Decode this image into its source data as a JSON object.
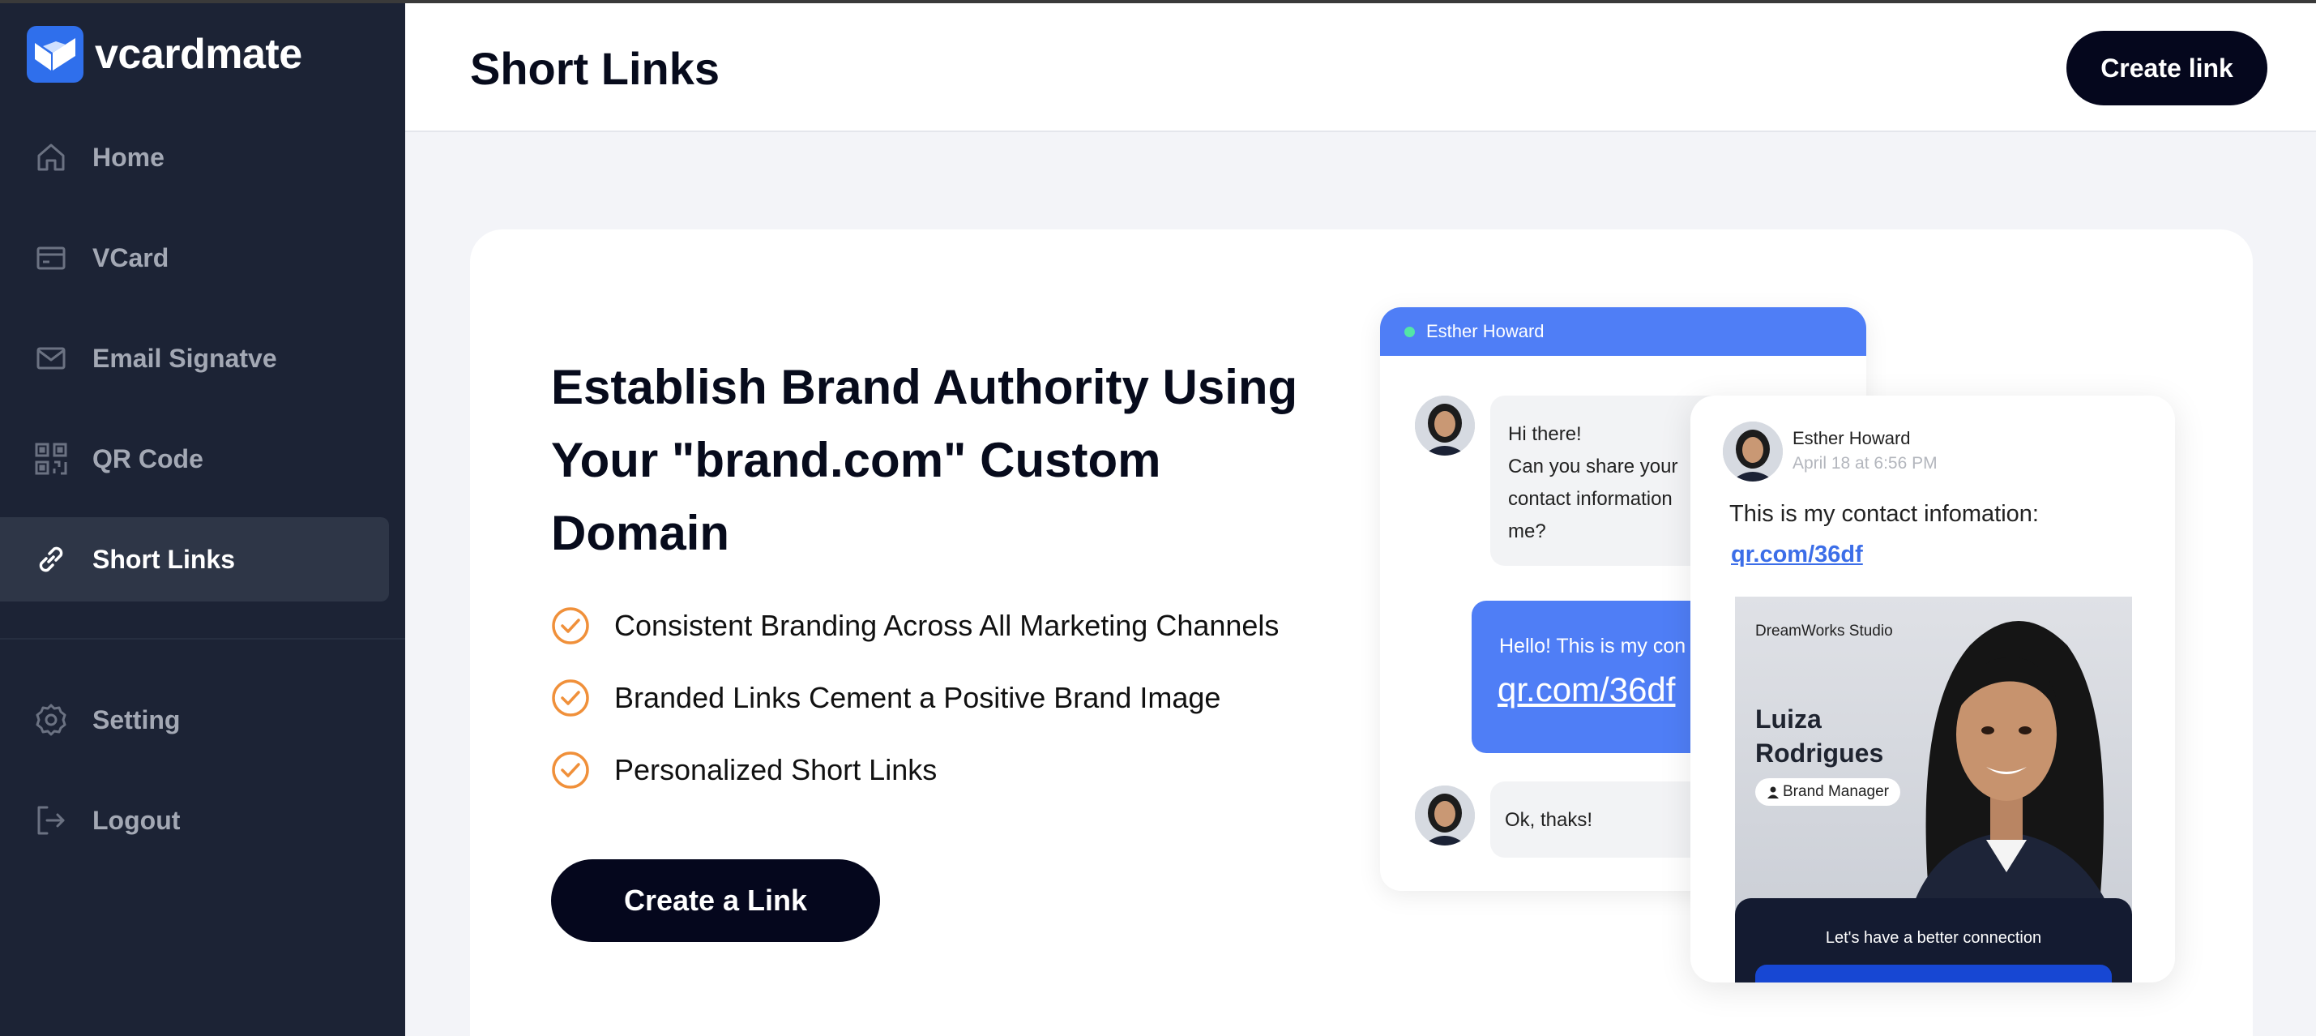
{
  "app": {
    "brand": "vcardmate"
  },
  "sidebar": {
    "items": [
      {
        "label": "Home",
        "icon": "home-icon"
      },
      {
        "label": "VCard",
        "icon": "card-icon"
      },
      {
        "label": "Email Signatve",
        "icon": "mail-icon"
      },
      {
        "label": "QR Code",
        "icon": "qr-code-icon"
      },
      {
        "label": "Short Links",
        "icon": "link-icon",
        "active": true
      },
      {
        "label": "Setting",
        "icon": "gear-icon"
      },
      {
        "label": "Logout",
        "icon": "logout-icon"
      }
    ]
  },
  "header": {
    "title": "Short Links",
    "create_label": "Create link"
  },
  "hero": {
    "title": "Establish Brand Authority Using Your \"brand.com\" Custom Domain",
    "features": [
      "Consistent Branding Across All Marketing Channels",
      "Branded Links Cement a Positive Brand Image",
      "Personalized Short Links"
    ],
    "cta_label": "Create a Link"
  },
  "illustration": {
    "chat": {
      "contact_name": "Esther Howard",
      "msg1_line1": "Hi there!",
      "msg1_line2": "Can you share your",
      "msg1_line3": "contact information",
      "msg1_line4": "me?",
      "reply_text": "Hello! This is my con",
      "reply_link": "qr.com/36df",
      "msg2": "Ok, thaks!"
    },
    "contact_card": {
      "name": "Esther Howard",
      "date": "April 18 at 6:56 PM",
      "message": "This is my contact infomation:",
      "link": "qr.com/36df",
      "studio": "DreamWorks Studio",
      "person": "Luiza Rodrigues",
      "role": "Brand Manager",
      "footer": "Let's have a better connection"
    }
  },
  "colors": {
    "sidebar": "#1c2335",
    "accent": "#4f7ef6",
    "button": "#05071d",
    "check": "#f0903a"
  }
}
